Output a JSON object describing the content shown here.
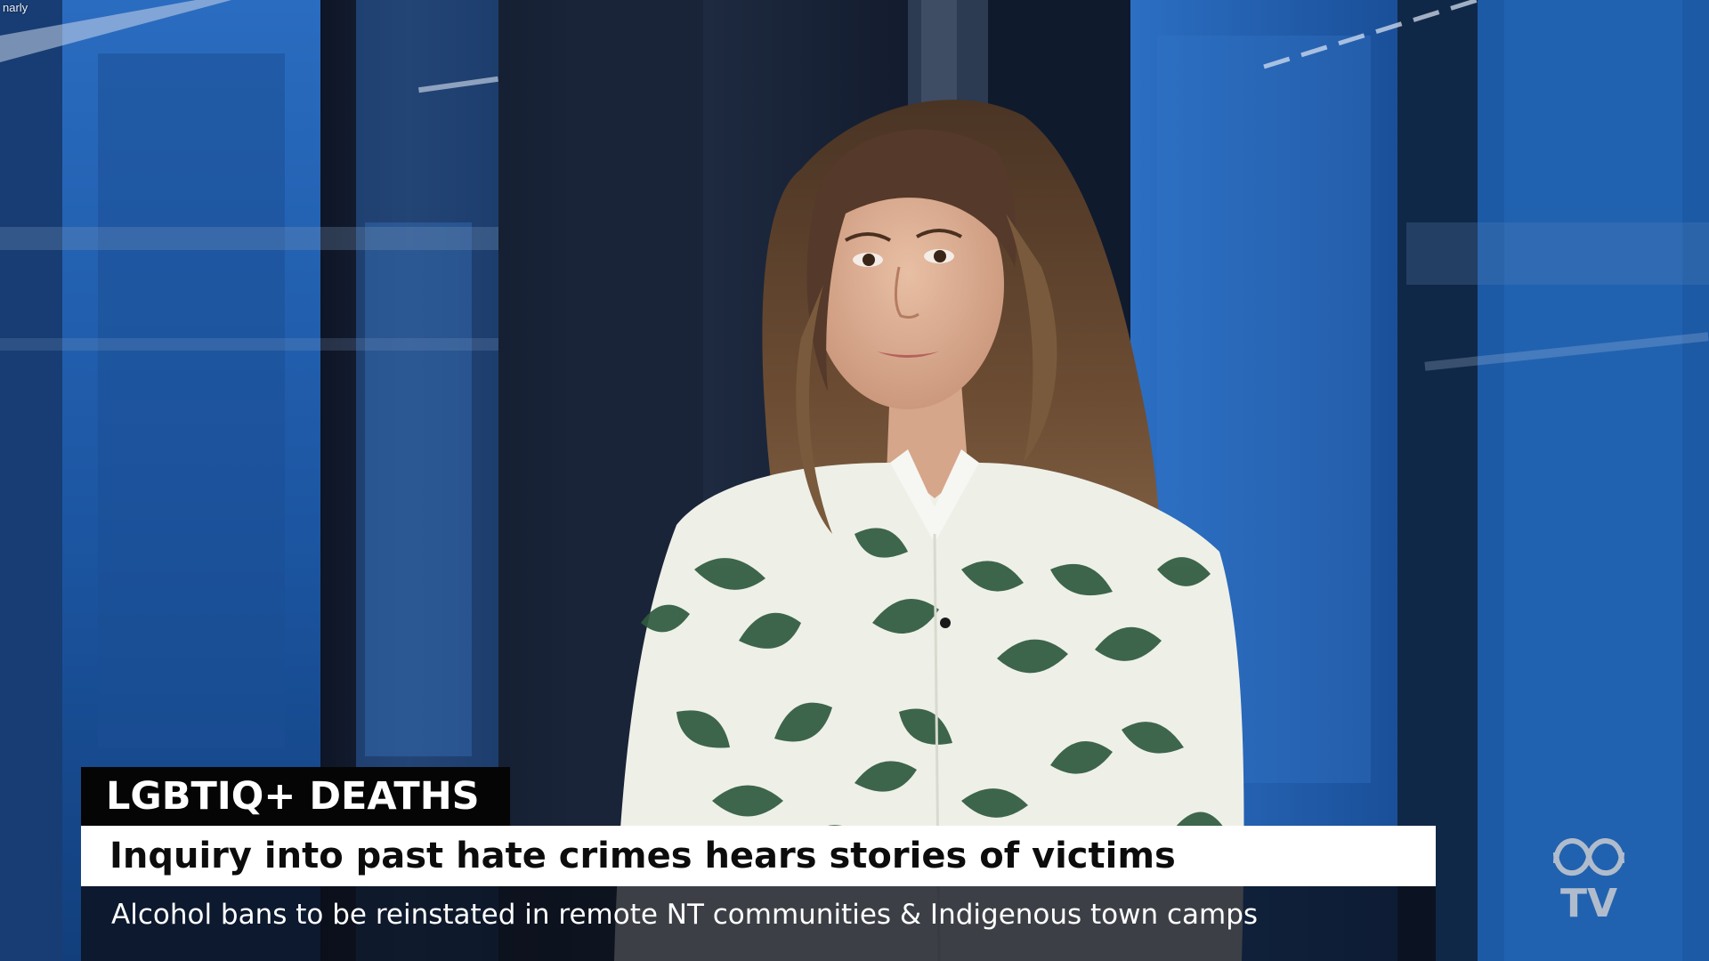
{
  "overlay": {
    "corner_text": "narly",
    "topic": "LGBTIQ+ DEATHS",
    "headline": "Inquiry into past hate crimes hears stories of victims",
    "ticker": "Alcohol bans to be reinstated in remote NT communities & Indigenous town camps"
  },
  "logo": {
    "icon": "abc-tv-logo-icon",
    "label": "TV"
  },
  "colors": {
    "studio_blue": "#1f5fb0",
    "topic_bg": "#050505",
    "headline_bg": "#ffffff",
    "shirt_green": "#2f5a3e",
    "shirt_base": "#eef0e8",
    "hair": "#6a4a30"
  }
}
